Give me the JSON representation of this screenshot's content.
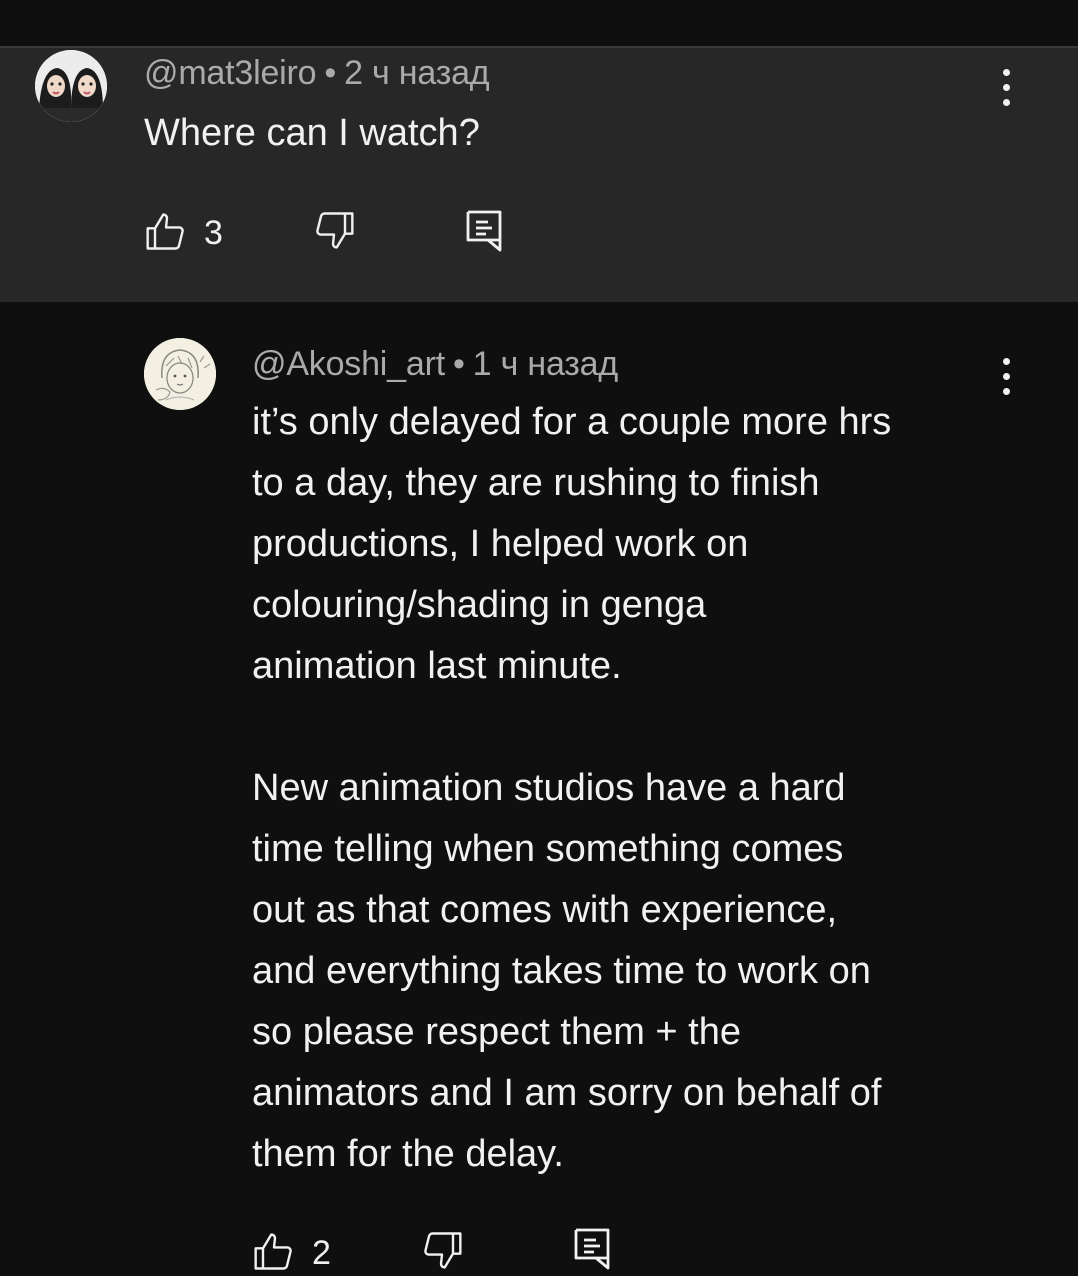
{
  "parent": {
    "author": "@mat3leiro",
    "separator": "•",
    "time": "2 ч назад",
    "text": "Where can I watch?",
    "like_count": "3"
  },
  "reply": {
    "author": "@Akoshi_art",
    "separator": "•",
    "time": "1 ч назад",
    "text": "it’s only delayed for a couple more hrs\nto a day, they are rushing to finish\nproductions, I helped work on\ncolouring/shading in genga\nanimation last minute.\n\nNew animation studios have a hard\ntime telling when something comes\nout as that comes with experience,\nand everything takes time to work on\nso please respect them + the\nanimators and I am sorry on behalf of\nthem for the delay.",
    "like_count": "2"
  },
  "colors": {
    "background": "#0f0f0f",
    "highlight": "#272727",
    "text": "#f1f1f1",
    "meta": "#aaaaaa"
  },
  "icons": [
    "thumbs-up-icon",
    "thumbs-down-icon",
    "reply-icon",
    "more-vert-icon"
  ]
}
